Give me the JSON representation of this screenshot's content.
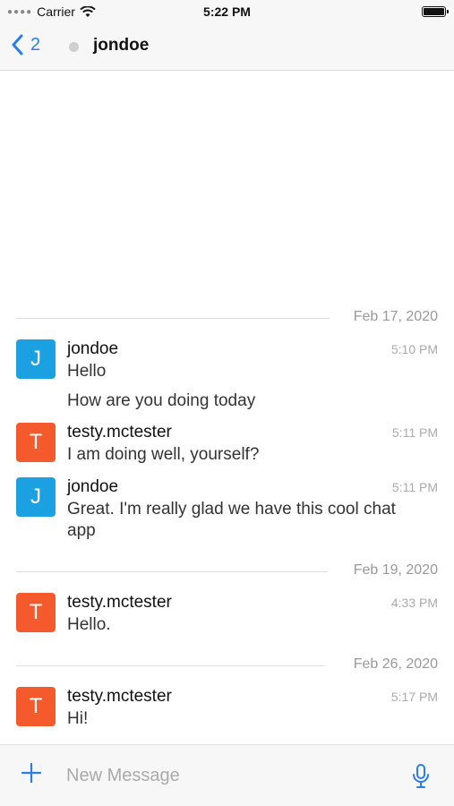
{
  "status_bar": {
    "carrier": "Carrier",
    "time": "5:22 PM"
  },
  "nav": {
    "back_count": "2",
    "title": "jondoe"
  },
  "date_separators": [
    "Feb 17, 2020",
    "Feb 19, 2020",
    "Feb 26, 2020"
  ],
  "messages": [
    {
      "avatar": "J",
      "user": "jondoe",
      "time": "5:10 PM",
      "text": "Hello"
    },
    {
      "text": "How are you doing today"
    },
    {
      "avatar": "T",
      "user": "testy.mctester",
      "time": "5:11 PM",
      "text": "I am doing well, yourself?"
    },
    {
      "avatar": "J",
      "user": "jondoe",
      "time": "5:11 PM",
      "text": "Great. I'm really glad we have this cool chat app"
    },
    {
      "avatar": "T",
      "user": "testy.mctester",
      "time": "4:33 PM",
      "text": "Hello."
    },
    {
      "avatar": "T",
      "user": "testy.mctester",
      "time": "5:17 PM",
      "text": "Hi!"
    }
  ],
  "composer": {
    "placeholder": "New Message"
  },
  "colors": {
    "accent": "#2b7de9",
    "avatar_blue": "#1ba1e2",
    "avatar_orange": "#f45a2c"
  }
}
